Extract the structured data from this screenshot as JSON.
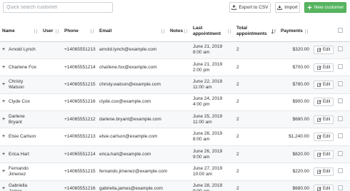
{
  "search": {
    "placeholder": "Quick search customer"
  },
  "toolbar": {
    "export_label": "Export to CSV",
    "import_label": "Import",
    "new_label": "New customer",
    "new_color": "#57b560"
  },
  "columns": {
    "name": "Name",
    "user": "User",
    "phone": "Phone",
    "email": "Email",
    "notes": "Notes",
    "last_appointment": "Last appointment",
    "total_appointments": "Total appointments",
    "payments": "Payments"
  },
  "edit_label": "Edit",
  "rows": [
    {
      "name": "Arnold Lynch",
      "phone": "+14065551213",
      "email": "arnold.lynch@example.com",
      "last": "June 21, 2019 8:00 am",
      "total": "2",
      "payments": "$320.00"
    },
    {
      "name": "Charlene Fox",
      "phone": "+14065551214",
      "email": "charlene.fox@example.com",
      "last": "June 21, 2019 2:00 pm",
      "total": "2",
      "payments": "$700.00"
    },
    {
      "name": "Christy Watson",
      "phone": "+14065551215",
      "email": "christy.watson@example.com",
      "last": "June 22, 2019 11:00 am",
      "total": "2",
      "payments": "$780.00"
    },
    {
      "name": "Clyde Cox",
      "phone": "+14065551216",
      "email": "clyde.cox@example.com",
      "last": "June 24, 2019 4:00 pm",
      "total": "2",
      "payments": "$900.00"
    },
    {
      "name": "Darlene Bryant",
      "phone": "+14065551212",
      "email": "darlene.bryant@example.com",
      "last": "June 25, 2019 11:00 am",
      "total": "2",
      "payments": "$680.00"
    },
    {
      "name": "Elsie Carlson",
      "phone": "+14065551213",
      "email": "elsie.carlson@example.com",
      "last": "June 26, 2019 8:00 am",
      "total": "2",
      "payments": "$1,240.00"
    },
    {
      "name": "Erica Hart",
      "phone": "+14065551214",
      "email": "erica.hart@example.com",
      "last": "June 26, 2019 9:00 am",
      "total": "2",
      "payments": "$820.00"
    },
    {
      "name": "Fernando Jimenez",
      "phone": "+14065551215",
      "email": "fernando.jimenez@example.com",
      "last": "June 27, 2019 10:00 am",
      "total": "2",
      "payments": "$220.00"
    },
    {
      "name": "Gabriella James",
      "phone": "+14065551216",
      "email": "gabriella.james@example.com",
      "last": "June 28, 2019 9:00 am",
      "total": "2",
      "payments": "$680.00"
    }
  ]
}
